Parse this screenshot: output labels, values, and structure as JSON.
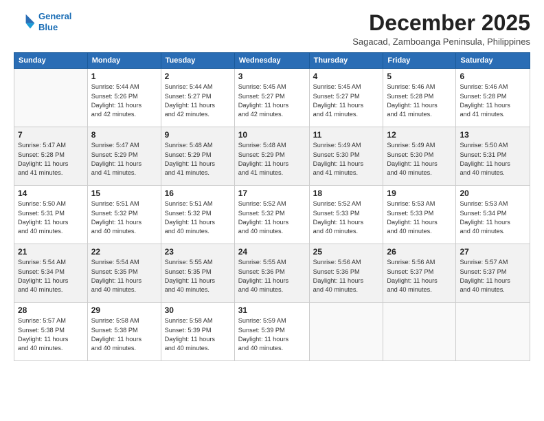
{
  "logo": {
    "line1": "General",
    "line2": "Blue"
  },
  "title": "December 2025",
  "subtitle": "Sagacad, Zamboanga Peninsula, Philippines",
  "days_of_week": [
    "Sunday",
    "Monday",
    "Tuesday",
    "Wednesday",
    "Thursday",
    "Friday",
    "Saturday"
  ],
  "weeks": [
    [
      {
        "day": "",
        "info": ""
      },
      {
        "day": "1",
        "info": "Sunrise: 5:44 AM\nSunset: 5:26 PM\nDaylight: 11 hours\nand 42 minutes."
      },
      {
        "day": "2",
        "info": "Sunrise: 5:44 AM\nSunset: 5:27 PM\nDaylight: 11 hours\nand 42 minutes."
      },
      {
        "day": "3",
        "info": "Sunrise: 5:45 AM\nSunset: 5:27 PM\nDaylight: 11 hours\nand 42 minutes."
      },
      {
        "day": "4",
        "info": "Sunrise: 5:45 AM\nSunset: 5:27 PM\nDaylight: 11 hours\nand 41 minutes."
      },
      {
        "day": "5",
        "info": "Sunrise: 5:46 AM\nSunset: 5:28 PM\nDaylight: 11 hours\nand 41 minutes."
      },
      {
        "day": "6",
        "info": "Sunrise: 5:46 AM\nSunset: 5:28 PM\nDaylight: 11 hours\nand 41 minutes."
      }
    ],
    [
      {
        "day": "7",
        "info": "Sunrise: 5:47 AM\nSunset: 5:28 PM\nDaylight: 11 hours\nand 41 minutes."
      },
      {
        "day": "8",
        "info": "Sunrise: 5:47 AM\nSunset: 5:29 PM\nDaylight: 11 hours\nand 41 minutes."
      },
      {
        "day": "9",
        "info": "Sunrise: 5:48 AM\nSunset: 5:29 PM\nDaylight: 11 hours\nand 41 minutes."
      },
      {
        "day": "10",
        "info": "Sunrise: 5:48 AM\nSunset: 5:29 PM\nDaylight: 11 hours\nand 41 minutes."
      },
      {
        "day": "11",
        "info": "Sunrise: 5:49 AM\nSunset: 5:30 PM\nDaylight: 11 hours\nand 41 minutes."
      },
      {
        "day": "12",
        "info": "Sunrise: 5:49 AM\nSunset: 5:30 PM\nDaylight: 11 hours\nand 40 minutes."
      },
      {
        "day": "13",
        "info": "Sunrise: 5:50 AM\nSunset: 5:31 PM\nDaylight: 11 hours\nand 40 minutes."
      }
    ],
    [
      {
        "day": "14",
        "info": "Sunrise: 5:50 AM\nSunset: 5:31 PM\nDaylight: 11 hours\nand 40 minutes."
      },
      {
        "day": "15",
        "info": "Sunrise: 5:51 AM\nSunset: 5:32 PM\nDaylight: 11 hours\nand 40 minutes."
      },
      {
        "day": "16",
        "info": "Sunrise: 5:51 AM\nSunset: 5:32 PM\nDaylight: 11 hours\nand 40 minutes."
      },
      {
        "day": "17",
        "info": "Sunrise: 5:52 AM\nSunset: 5:32 PM\nDaylight: 11 hours\nand 40 minutes."
      },
      {
        "day": "18",
        "info": "Sunrise: 5:52 AM\nSunset: 5:33 PM\nDaylight: 11 hours\nand 40 minutes."
      },
      {
        "day": "19",
        "info": "Sunrise: 5:53 AM\nSunset: 5:33 PM\nDaylight: 11 hours\nand 40 minutes."
      },
      {
        "day": "20",
        "info": "Sunrise: 5:53 AM\nSunset: 5:34 PM\nDaylight: 11 hours\nand 40 minutes."
      }
    ],
    [
      {
        "day": "21",
        "info": "Sunrise: 5:54 AM\nSunset: 5:34 PM\nDaylight: 11 hours\nand 40 minutes."
      },
      {
        "day": "22",
        "info": "Sunrise: 5:54 AM\nSunset: 5:35 PM\nDaylight: 11 hours\nand 40 minutes."
      },
      {
        "day": "23",
        "info": "Sunrise: 5:55 AM\nSunset: 5:35 PM\nDaylight: 11 hours\nand 40 minutes."
      },
      {
        "day": "24",
        "info": "Sunrise: 5:55 AM\nSunset: 5:36 PM\nDaylight: 11 hours\nand 40 minutes."
      },
      {
        "day": "25",
        "info": "Sunrise: 5:56 AM\nSunset: 5:36 PM\nDaylight: 11 hours\nand 40 minutes."
      },
      {
        "day": "26",
        "info": "Sunrise: 5:56 AM\nSunset: 5:37 PM\nDaylight: 11 hours\nand 40 minutes."
      },
      {
        "day": "27",
        "info": "Sunrise: 5:57 AM\nSunset: 5:37 PM\nDaylight: 11 hours\nand 40 minutes."
      }
    ],
    [
      {
        "day": "28",
        "info": "Sunrise: 5:57 AM\nSunset: 5:38 PM\nDaylight: 11 hours\nand 40 minutes."
      },
      {
        "day": "29",
        "info": "Sunrise: 5:58 AM\nSunset: 5:38 PM\nDaylight: 11 hours\nand 40 minutes."
      },
      {
        "day": "30",
        "info": "Sunrise: 5:58 AM\nSunset: 5:39 PM\nDaylight: 11 hours\nand 40 minutes."
      },
      {
        "day": "31",
        "info": "Sunrise: 5:59 AM\nSunset: 5:39 PM\nDaylight: 11 hours\nand 40 minutes."
      },
      {
        "day": "",
        "info": ""
      },
      {
        "day": "",
        "info": ""
      },
      {
        "day": "",
        "info": ""
      }
    ]
  ]
}
